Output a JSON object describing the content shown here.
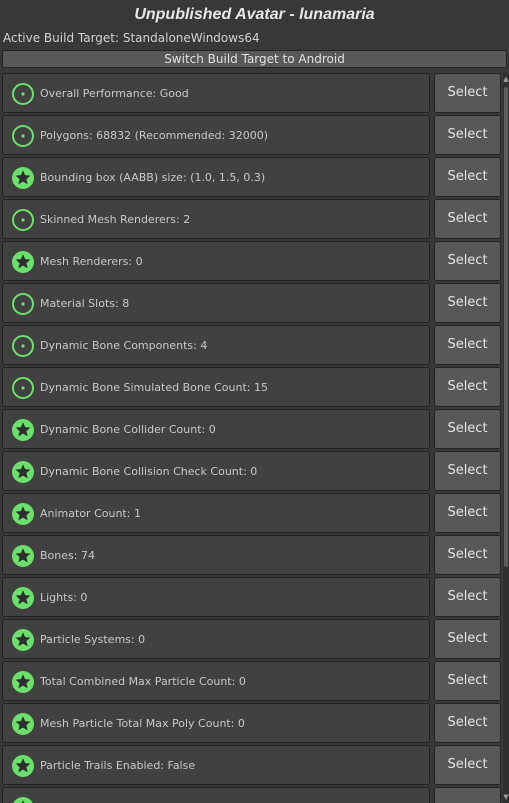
{
  "header": {
    "title": "Unpublished Avatar - lunamaria",
    "build_target": "Active Build Target: StandaloneWindows64",
    "switch_label": "Switch Build Target to Android"
  },
  "colors": {
    "accent_green": "#6be06b",
    "panel_bg": "#414141",
    "button_bg": "#585858"
  },
  "rows": [
    {
      "label": "Overall Performance: Good",
      "icon": "good-dot-icon",
      "select": "Select"
    },
    {
      "label": "Polygons: 68832 (Recommended: 32000)",
      "icon": "good-dot-icon",
      "select": "Select"
    },
    {
      "label": "Bounding box (AABB) size: (1.0, 1.5, 0.3)",
      "icon": "excellent-star-icon",
      "select": "Select"
    },
    {
      "label": "Skinned Mesh Renderers: 2",
      "icon": "good-dot-icon",
      "select": "Select"
    },
    {
      "label": "Mesh Renderers: 0",
      "icon": "excellent-star-icon",
      "select": "Select"
    },
    {
      "label": "Material Slots: 8",
      "icon": "good-dot-icon",
      "select": "Select"
    },
    {
      "label": "Dynamic Bone Components: 4",
      "icon": "good-dot-icon",
      "select": "Select"
    },
    {
      "label": "Dynamic Bone Simulated Bone Count: 15",
      "icon": "good-dot-icon",
      "select": "Select"
    },
    {
      "label": "Dynamic Bone Collider Count: 0",
      "icon": "excellent-star-icon",
      "select": "Select"
    },
    {
      "label": "Dynamic Bone Collision Check Count: 0",
      "icon": "excellent-star-icon",
      "select": "Select"
    },
    {
      "label": "Animator Count: 1",
      "icon": "excellent-star-icon",
      "select": "Select"
    },
    {
      "label": "Bones: 74",
      "icon": "excellent-star-icon",
      "select": "Select"
    },
    {
      "label": "Lights: 0",
      "icon": "excellent-star-icon",
      "select": "Select"
    },
    {
      "label": "Particle Systems: 0",
      "icon": "excellent-star-icon",
      "select": "Select"
    },
    {
      "label": "Total Combined Max Particle Count: 0",
      "icon": "excellent-star-icon",
      "select": "Select"
    },
    {
      "label": "Mesh Particle Total Max Poly Count: 0",
      "icon": "excellent-star-icon",
      "select": "Select"
    },
    {
      "label": "Particle Trails Enabled: False",
      "icon": "excellent-star-icon",
      "select": "Select"
    },
    {
      "label": "",
      "icon": "excellent-star-icon",
      "select": ""
    }
  ]
}
